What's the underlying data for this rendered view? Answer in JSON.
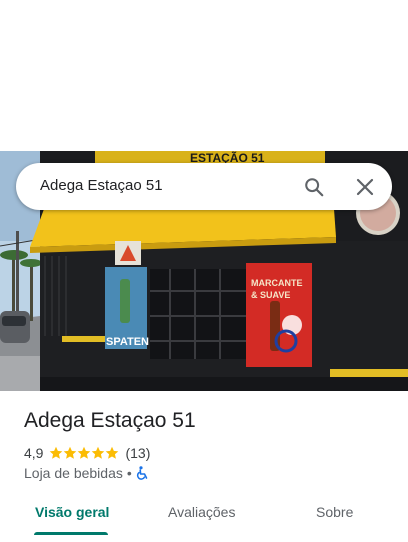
{
  "search": {
    "query": "Adega Estaçao 51"
  },
  "place": {
    "name": "Adega Estaçao 51",
    "rating": "4,9",
    "rating_value": 4.9,
    "stars_total": 5,
    "reviews_count": "(13)",
    "category": "Loja de bebidas",
    "separator": "•"
  },
  "photo": {
    "sign_text": "ESTAÇÃO 51",
    "poster_left_text": "SPATEN",
    "poster_right_line1": "MARCANTE",
    "poster_right_line2": "& SUAVE"
  },
  "tabs": [
    {
      "label": "Visão geral"
    },
    {
      "label": "Avaliações"
    },
    {
      "label": "Sobre"
    }
  ],
  "colors": {
    "accent": "#00796b",
    "star": "#fbbc04",
    "awning": "#f2c21b"
  }
}
